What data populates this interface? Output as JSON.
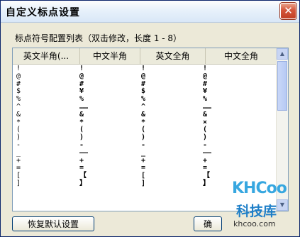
{
  "window": {
    "title": "自定义标点设置",
    "close_symbol": "✕"
  },
  "caption": "标点符号配置列表（双击修改，长度 1 - 8）",
  "table": {
    "headers": [
      "英文半角(...",
      "中文半角",
      "英文全角",
      "中文全角"
    ],
    "rows": [
      [
        "!",
        "!",
        "!",
        "!"
      ],
      [
        "@",
        "@",
        "@",
        "@"
      ],
      [
        "#",
        "#",
        "#",
        "#"
      ],
      [
        "$",
        "¥",
        "$",
        "¥"
      ],
      [
        "%",
        "%",
        "%",
        "%"
      ],
      [
        "^",
        "……",
        "^",
        "……"
      ],
      [
        "&",
        "&",
        "&",
        "&"
      ],
      [
        "*",
        "*",
        "*",
        "×"
      ],
      [
        "(",
        "(",
        "(",
        "("
      ],
      [
        ")",
        ")",
        ")",
        ")"
      ],
      [
        "-",
        "-",
        "-",
        "-"
      ],
      [
        "_",
        "——",
        "_",
        "——"
      ],
      [
        "+",
        "+",
        "+",
        "+"
      ],
      [
        "=",
        "=",
        "=",
        "="
      ],
      [
        "[",
        "【",
        "[",
        "【"
      ],
      [
        "]",
        "】",
        "]",
        "】"
      ]
    ]
  },
  "buttons": {
    "restore": "恢复默认设置",
    "ok": "确"
  },
  "watermark": {
    "logo": "KHCoo",
    "name": "科技库",
    "url": "khcoo.com"
  },
  "scrollbar": {
    "up_symbol": "▲",
    "down_symbol": "▼"
  }
}
